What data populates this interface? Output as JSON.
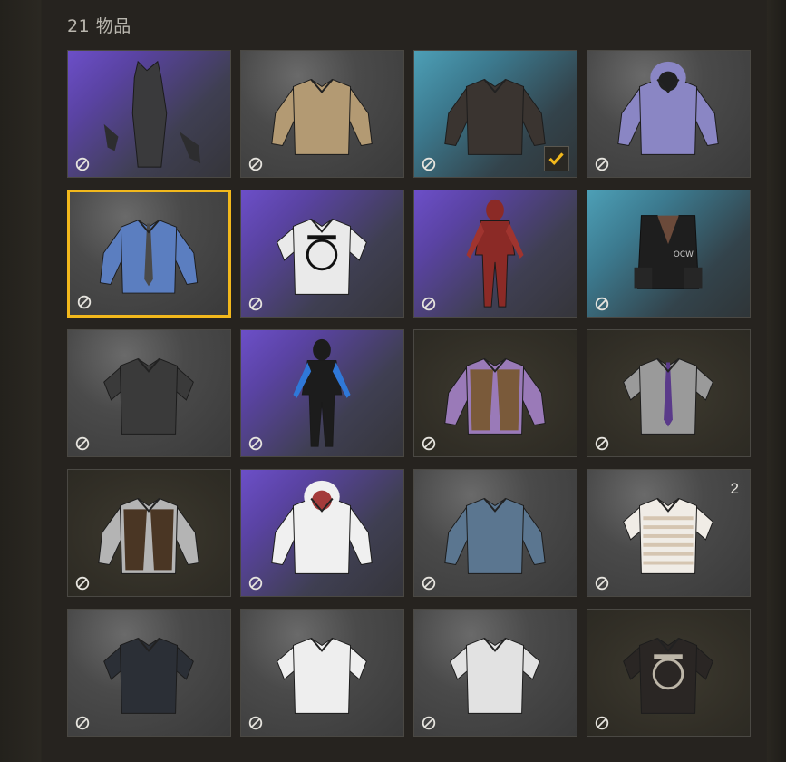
{
  "header": {
    "count_label": "21 物品"
  },
  "colors": {
    "selection": "#f2b81c",
    "check": "#f2b81c"
  },
  "items": [
    {
      "name": "werewolf-outfit",
      "bg": "purple"
    },
    {
      "name": "tan-longsleeve",
      "bg": "gray"
    },
    {
      "name": "leather-jacket",
      "bg": "blue",
      "equipped": true
    },
    {
      "name": "iridescent-harness-jacket",
      "bg": "gray"
    },
    {
      "name": "blue-shirt-tie",
      "bg": "gray",
      "selected": true
    },
    {
      "name": "cow-print-top",
      "bg": "purple"
    },
    {
      "name": "red-jumpsuit",
      "bg": "purple"
    },
    {
      "name": "tactical-vest",
      "bg": "blue"
    },
    {
      "name": "black-polo",
      "bg": "gray"
    },
    {
      "name": "moto-suit",
      "bg": "purple"
    },
    {
      "name": "leopard-vest-shirt",
      "bg": "brown"
    },
    {
      "name": "gray-shirt-purple-tie",
      "bg": "brown"
    },
    {
      "name": "brown-vest-shirt",
      "bg": "brown"
    },
    {
      "name": "cat-hoodie",
      "bg": "purple"
    },
    {
      "name": "denim-shirt",
      "bg": "gray"
    },
    {
      "name": "striped-polo",
      "bg": "gray",
      "count": "2"
    },
    {
      "name": "black-shortsleeve-shirt",
      "bg": "gray"
    },
    {
      "name": "white-tshirt",
      "bg": "gray"
    },
    {
      "name": "white-vneck",
      "bg": "gray"
    },
    {
      "name": "winner-tshirt",
      "bg": "brown"
    }
  ]
}
